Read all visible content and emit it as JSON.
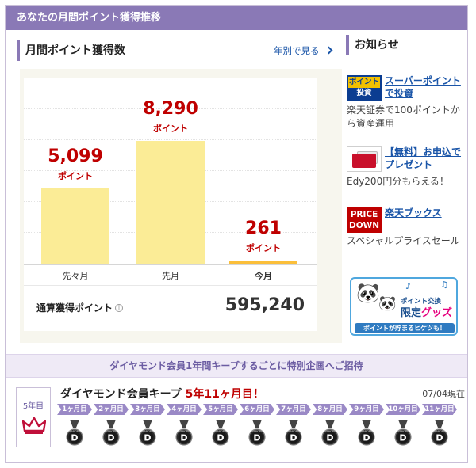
{
  "header": {
    "title": "あなたの月間ポイント獲得推移"
  },
  "left_panel": {
    "title": "月間ポイント獲得数",
    "yearly_link": "年別で見る"
  },
  "chart_data": {
    "type": "bar",
    "categories": [
      "先々月",
      "先月",
      "今月"
    ],
    "values": [
      5099,
      8290,
      261
    ],
    "value_labels": [
      "5,099",
      "8,290",
      "261"
    ],
    "unit": "ポイント",
    "highlight_index": 2,
    "colors": {
      "bar": "#fbec96",
      "current_bar": "#fbbf3a",
      "value_text": "#bf0000"
    }
  },
  "total": {
    "label": "通算獲得ポイント",
    "info_icon": "info-icon",
    "value": "595,240"
  },
  "news": {
    "title": "お知らせ",
    "items": [
      {
        "thumb_line1": "ポイント",
        "thumb_line2": "投資",
        "link": "スーパーポイントで投資",
        "desc": "楽天証券で100ポイントから資産運用"
      },
      {
        "link": "【無料】お申込でプレゼント",
        "desc": "Edy200円分もらえる！"
      },
      {
        "thumb_line1": "PRICE",
        "thumb_line2": "DOWN",
        "link": "楽天ブックス",
        "desc": "スペシャルプライスセール"
      }
    ],
    "banner": {
      "line1": "ポイント交換",
      "line2a": "限定",
      "line2b": "グッズ",
      "line3": "ポイントが貯まるヒケツも！"
    }
  },
  "band": {
    "text": "ダイヤモンド会員1年間キープするごとに特別企画へご招待"
  },
  "diamond": {
    "year_label": "5年目",
    "keep_title": "ダイヤモンド会員キープ",
    "keep_months": "5年11ヶ月目！",
    "as_of": "07/04現在",
    "months": [
      "1ヶ月目",
      "2ヶ月目",
      "3ヶ月目",
      "4ヶ月目",
      "5ヶ月目",
      "6ヶ月目",
      "7ヶ月目",
      "8ヶ月目",
      "9ヶ月目",
      "10ヶ月目",
      "11ヶ月目"
    ],
    "medal_letter": "D",
    "medal_top_text": "DIAMOND"
  }
}
